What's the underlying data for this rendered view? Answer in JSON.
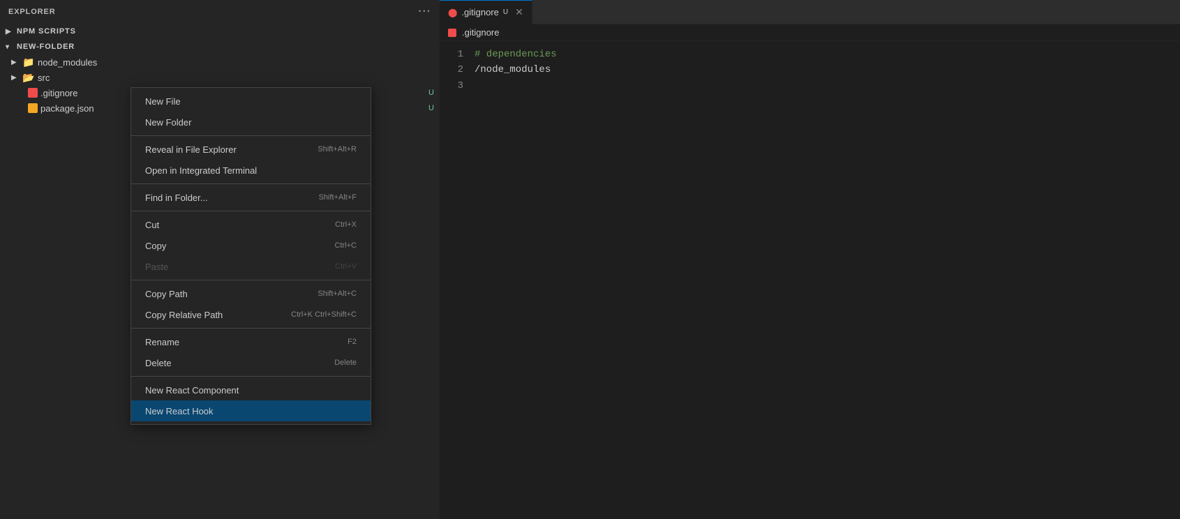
{
  "sidebar": {
    "title": "EXPLORER",
    "sections": {
      "npm": {
        "label": "NPM SCRIPTS",
        "collapsed": true
      },
      "folder": {
        "label": "NEW-FOLDER",
        "expanded": true
      }
    },
    "tree": {
      "node_modules": {
        "label": "node_modules",
        "type": "folder",
        "collapsed": true
      },
      "src": {
        "label": "src",
        "type": "folder",
        "collapsed": true
      },
      "gitignore": {
        "label": ".gitignore",
        "badge": "U"
      },
      "package_json": {
        "label": "package.json",
        "badge": "U"
      }
    }
  },
  "context_menu": {
    "items": [
      {
        "id": "new-file",
        "label": "New File",
        "shortcut": "",
        "disabled": false,
        "highlighted": false
      },
      {
        "id": "new-folder",
        "label": "New Folder",
        "shortcut": "",
        "disabled": false,
        "highlighted": false
      },
      {
        "id": "sep1",
        "type": "separator"
      },
      {
        "id": "reveal-explorer",
        "label": "Reveal in File Explorer",
        "shortcut": "Shift+Alt+R",
        "disabled": false,
        "highlighted": false
      },
      {
        "id": "open-terminal",
        "label": "Open in Integrated Terminal",
        "shortcut": "",
        "disabled": false,
        "highlighted": false
      },
      {
        "id": "sep2",
        "type": "separator"
      },
      {
        "id": "find-folder",
        "label": "Find in Folder...",
        "shortcut": "Shift+Alt+F",
        "disabled": false,
        "highlighted": false
      },
      {
        "id": "sep3",
        "type": "separator"
      },
      {
        "id": "cut",
        "label": "Cut",
        "shortcut": "Ctrl+X",
        "disabled": false,
        "highlighted": false
      },
      {
        "id": "copy",
        "label": "Copy",
        "shortcut": "Ctrl+C",
        "disabled": false,
        "highlighted": false
      },
      {
        "id": "paste",
        "label": "Paste",
        "shortcut": "Ctrl+V",
        "disabled": true,
        "highlighted": false
      },
      {
        "id": "sep4",
        "type": "separator"
      },
      {
        "id": "copy-path",
        "label": "Copy Path",
        "shortcut": "Shift+Alt+C",
        "disabled": false,
        "highlighted": false
      },
      {
        "id": "copy-relative-path",
        "label": "Copy Relative Path",
        "shortcut": "Ctrl+K Ctrl+Shift+C",
        "disabled": false,
        "highlighted": false
      },
      {
        "id": "sep5",
        "type": "separator"
      },
      {
        "id": "rename",
        "label": "Rename",
        "shortcut": "F2",
        "disabled": false,
        "highlighted": false
      },
      {
        "id": "delete",
        "label": "Delete",
        "shortcut": "Delete",
        "disabled": false,
        "highlighted": false
      },
      {
        "id": "sep6",
        "type": "separator"
      },
      {
        "id": "new-react-component",
        "label": "New React Component",
        "shortcut": "",
        "disabled": false,
        "highlighted": false
      },
      {
        "id": "new-react-hook",
        "label": "New React Hook",
        "shortcut": "",
        "disabled": false,
        "highlighted": true
      }
    ]
  },
  "editor": {
    "tab": {
      "filename": ".gitignore",
      "modified": "U",
      "active": true
    },
    "breadcrumb": ".gitignore",
    "lines": [
      {
        "number": "1",
        "content": "# dependencies",
        "type": "comment"
      },
      {
        "number": "2",
        "content": "/node_modules",
        "type": "path"
      },
      {
        "number": "3",
        "content": "",
        "type": "empty"
      }
    ]
  }
}
